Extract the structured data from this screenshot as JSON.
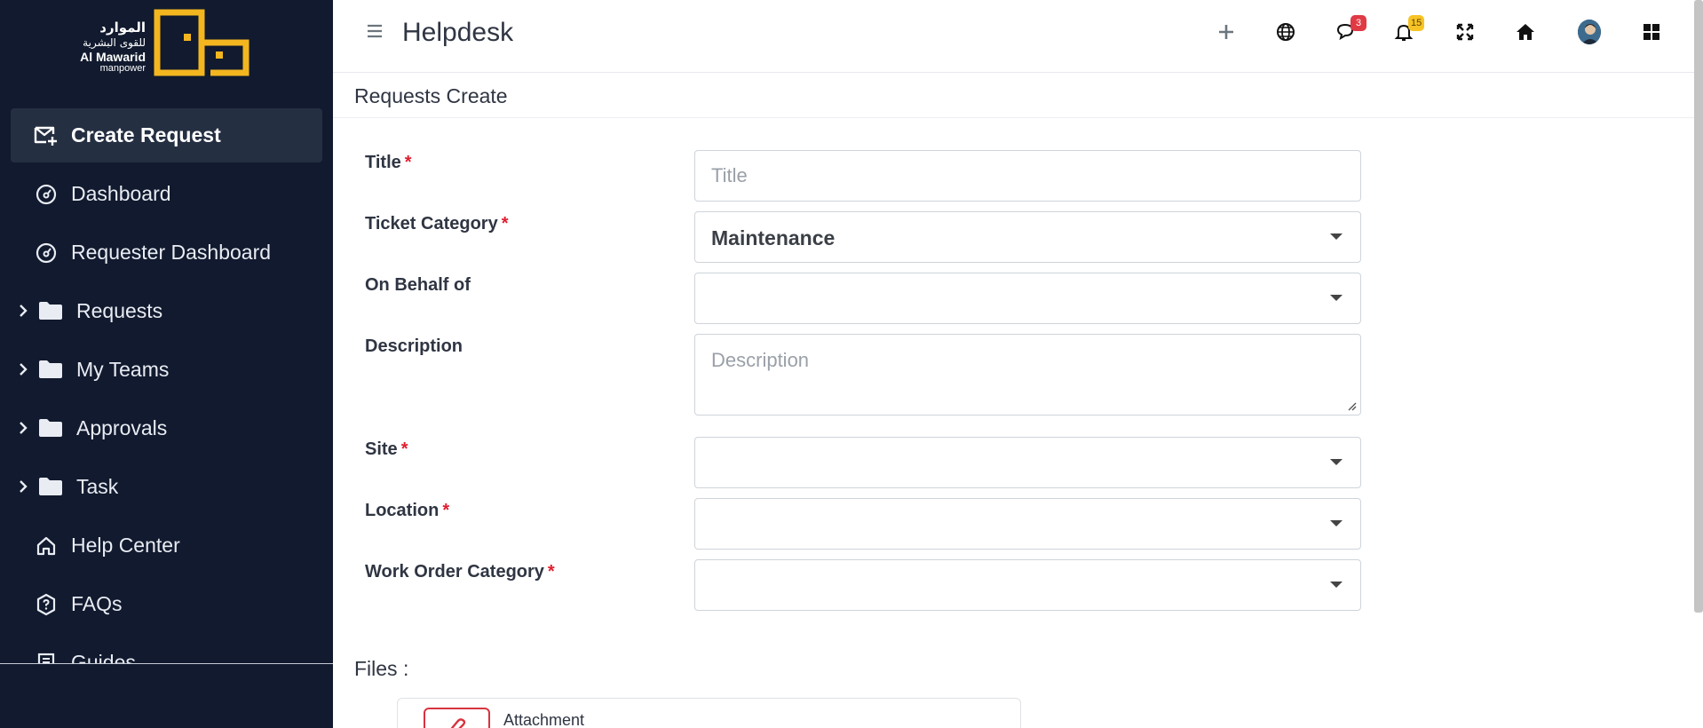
{
  "brand": {
    "arabic_line1": "الموارد",
    "arabic_line2": "للقوى البشرية",
    "english_name": "Al Mawarid",
    "english_sub": "manpower"
  },
  "sidebar": {
    "items": [
      {
        "label": "Create Request",
        "icon": "envelope-plus-icon",
        "active": true
      },
      {
        "label": "Dashboard",
        "icon": "gauge-icon"
      },
      {
        "label": "Requester Dashboard",
        "icon": "gauge-icon"
      },
      {
        "label": "Requests",
        "icon": "folder-icon",
        "expandable": true
      },
      {
        "label": "My Teams",
        "icon": "folder-icon",
        "expandable": true
      },
      {
        "label": "Approvals",
        "icon": "folder-icon",
        "expandable": true
      },
      {
        "label": "Task",
        "icon": "folder-icon",
        "expandable": true
      },
      {
        "label": "Help Center",
        "icon": "home-icon"
      },
      {
        "label": "FAQs",
        "icon": "question-shield-icon"
      },
      {
        "label": "Guides",
        "icon": "book-icon"
      }
    ]
  },
  "header": {
    "title": "Helpdesk",
    "messages_count": "3",
    "notifications_count": "15"
  },
  "page": {
    "title": "Requests Create"
  },
  "form": {
    "title": {
      "label": "Title",
      "required": "*",
      "placeholder": "Title",
      "value": ""
    },
    "ticket_category": {
      "label": "Ticket Category",
      "required": "*",
      "value": "Maintenance"
    },
    "on_behalf_of": {
      "label": "On Behalf of",
      "value": ""
    },
    "description": {
      "label": "Description",
      "placeholder": "Description",
      "value": ""
    },
    "site": {
      "label": "Site",
      "required": "*",
      "value": ""
    },
    "location": {
      "label": "Location",
      "required": "*",
      "value": ""
    },
    "work_order_category": {
      "label": "Work Order Category",
      "required": "*",
      "value": ""
    }
  },
  "files": {
    "label": "Files :",
    "attachment_label": "Attachment"
  },
  "colors": {
    "sidebar_bg": "#111a2e",
    "sidebar_active": "#252f42",
    "brand_gold": "#f3b61f",
    "required_red": "#e11d2e",
    "badge_red": "#e03a45",
    "badge_yellow": "#f7c325"
  }
}
